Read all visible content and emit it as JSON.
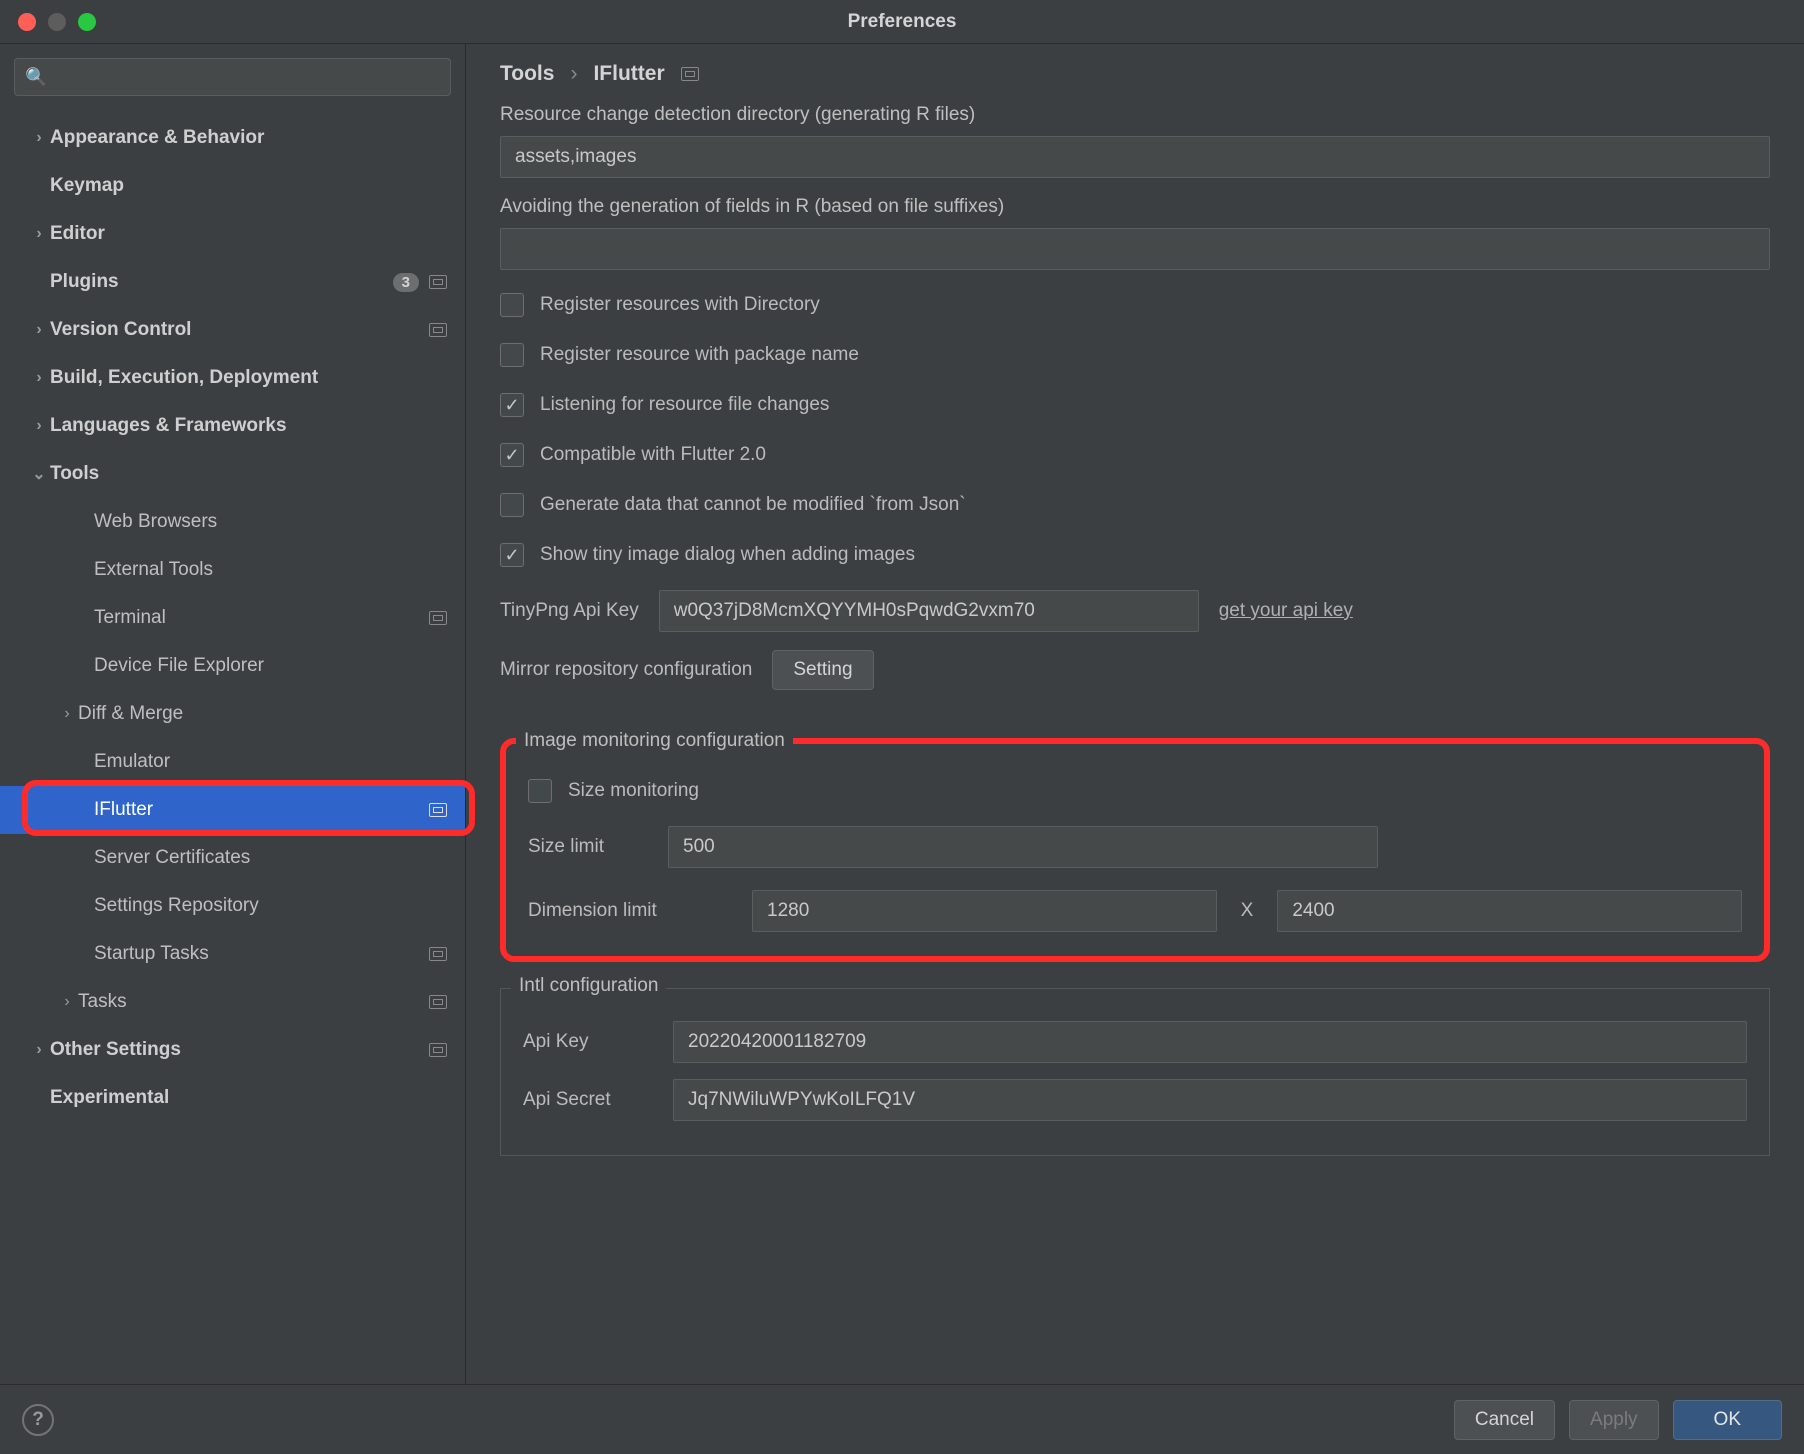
{
  "window": {
    "title": "Preferences"
  },
  "search": {
    "glyph": "🔍"
  },
  "sidebar": {
    "items": [
      {
        "label": "Appearance & Behavior",
        "chev": "›",
        "bold": true
      },
      {
        "label": "Keymap",
        "bold": true
      },
      {
        "label": "Editor",
        "chev": "›",
        "bold": true
      },
      {
        "label": "Plugins",
        "bold": true,
        "count": "3",
        "sq": true
      },
      {
        "label": "Version Control",
        "chev": "›",
        "bold": true,
        "sq": true
      },
      {
        "label": "Build, Execution, Deployment",
        "chev": "›",
        "bold": true
      },
      {
        "label": "Languages & Frameworks",
        "chev": "›",
        "bold": true
      },
      {
        "label": "Tools",
        "chev": "⌄",
        "bold": true
      },
      {
        "label": "Web Browsers",
        "sub": true
      },
      {
        "label": "External Tools",
        "sub": true
      },
      {
        "label": "Terminal",
        "sub": true,
        "sq": true
      },
      {
        "label": "Device File Explorer",
        "sub": true
      },
      {
        "label": "Diff & Merge",
        "sub": true,
        "chev": "›",
        "chevIndent": true
      },
      {
        "label": "Emulator",
        "sub": true
      },
      {
        "label": "IFlutter",
        "sub": true,
        "selected": true,
        "sq": true
      },
      {
        "label": "Server Certificates",
        "sub": true
      },
      {
        "label": "Settings Repository",
        "sub": true
      },
      {
        "label": "Startup Tasks",
        "sub": true,
        "sq": true
      },
      {
        "label": "Tasks",
        "sub": true,
        "chev": "›",
        "chevIndent": true,
        "sq": true
      },
      {
        "label": "Other Settings",
        "chev": "›",
        "bold": true,
        "sq": true
      },
      {
        "label": "Experimental",
        "bold": true
      }
    ]
  },
  "breadcrumb": {
    "a": "Tools",
    "sep": "›",
    "b": "IFlutter"
  },
  "fields": {
    "resourceDirLabel": "Resource change detection directory (generating R files)",
    "resourceDirValue": "assets,images",
    "avoidSuffixLabel": "Avoiding the generation of fields in R (based on file suffixes)",
    "avoidSuffixValue": "",
    "checkboxes": [
      {
        "label": "Register resources with Directory",
        "checked": false
      },
      {
        "label": "Register resource with package name",
        "checked": false
      },
      {
        "label": "Listening for resource file changes",
        "checked": true
      },
      {
        "label": "Compatible with Flutter 2.0",
        "checked": true
      },
      {
        "label": "Generate data that cannot be modified `from Json`",
        "checked": false
      },
      {
        "label": "Show tiny image dialog when adding images",
        "checked": true
      }
    ],
    "tinyPngLabel": "TinyPng Api Key",
    "tinyPngValue": "w0Q37jD8McmXQYYMH0sPqwdG2vxm70",
    "tinyPngLink": "get your api key",
    "mirrorLabel": "Mirror repository configuration",
    "mirrorBtn": "Setting",
    "imageMon": {
      "legend": "Image monitoring configuration",
      "sizeMonLabel": "Size monitoring",
      "sizeMonChecked": false,
      "sizeLimitLabel": "Size limit",
      "sizeLimitValue": "500",
      "dimLabel": "Dimension limit",
      "dimW": "1280",
      "dimSep": "X",
      "dimH": "2400"
    },
    "intl": {
      "legend": "Intl configuration",
      "apiKeyLabel": "Api Key",
      "apiKeyValue": "20220420001182709",
      "apiSecretLabel": "Api Secret",
      "apiSecretValue": "Jq7NWiluWPYwKoILFQ1V"
    }
  },
  "footer": {
    "cancel": "Cancel",
    "apply": "Apply",
    "ok": "OK"
  }
}
